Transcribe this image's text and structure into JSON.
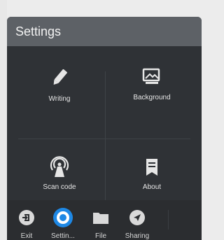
{
  "panel": {
    "title": "Settings"
  },
  "tiles": [
    {
      "label": "Writing",
      "icon": "pen-icon"
    },
    {
      "label": "Background",
      "icon": "image-icon"
    },
    {
      "label": "Scan code",
      "icon": "broadcast-icon"
    },
    {
      "label": "About",
      "icon": "document-icon"
    }
  ],
  "taskbar": [
    {
      "label": "Exit",
      "icon": "exit-icon"
    },
    {
      "label": "Settin...",
      "icon": "settings-icon"
    },
    {
      "label": "File",
      "icon": "folder-icon"
    },
    {
      "label": "Sharing",
      "icon": "share-icon"
    }
  ],
  "colors": {
    "accent": "#1e88e5",
    "panel_bg": "#2f3236",
    "header_bg": "#5d6166",
    "taskbar_bg": "#2b2d30"
  }
}
